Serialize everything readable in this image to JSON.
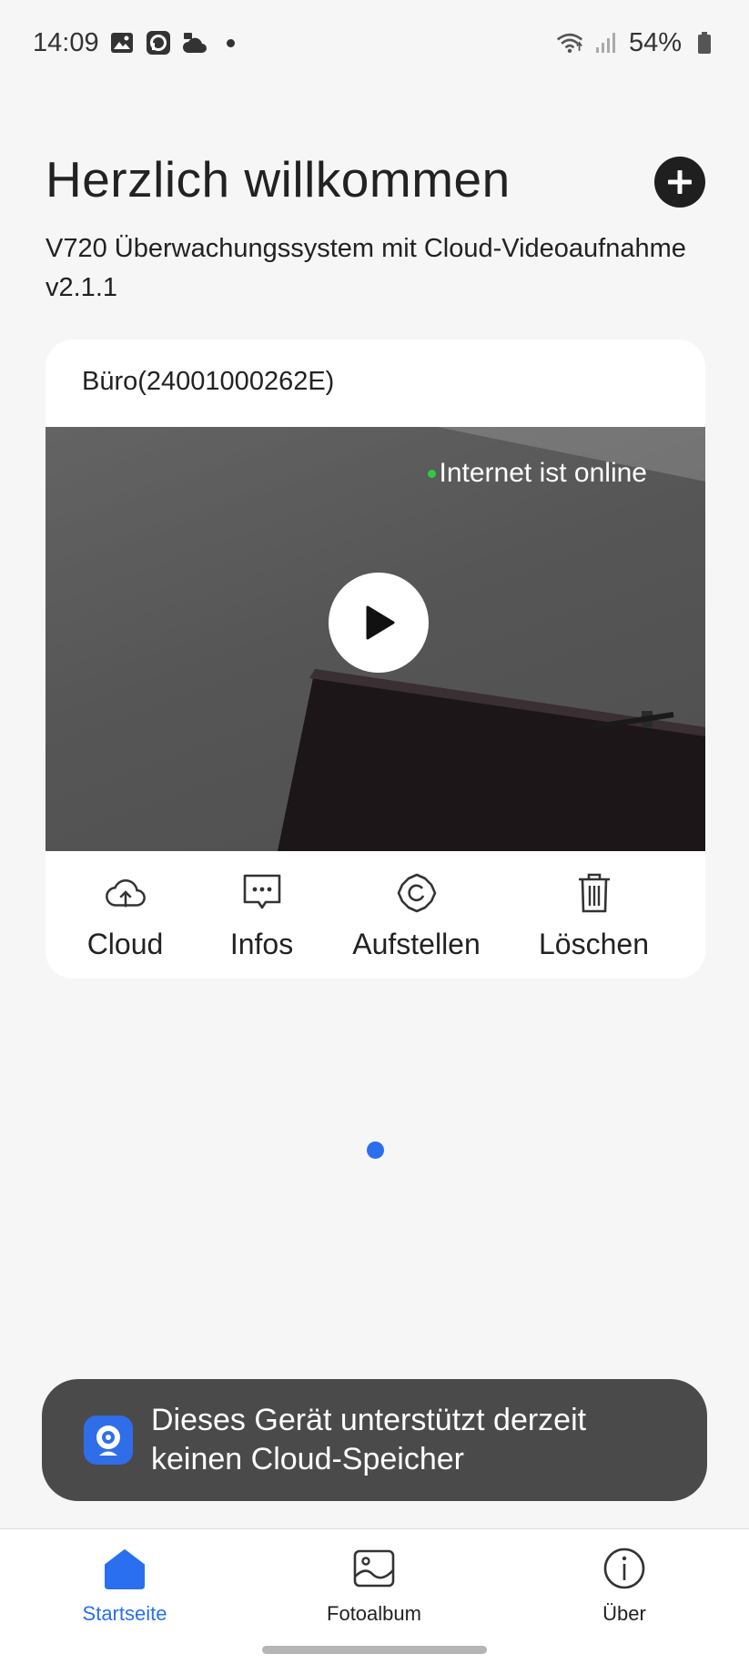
{
  "status_bar": {
    "time": "14:09",
    "battery": "54%",
    "icons": [
      "image-icon",
      "app-notification-icon",
      "cloud-camera-icon",
      "dot-icon",
      "wifi-icon",
      "signal-icon",
      "battery-icon"
    ]
  },
  "header": {
    "title": "Herzlich willkommen",
    "subtitle": "V720 Überwachungssystem mit Cloud-Videoaufnahme v2.1.1",
    "add_icon": "plus-circle-icon"
  },
  "device_card": {
    "name": "Büro(24001000262E)",
    "status": "Internet ist online",
    "status_color": "#2ecc40",
    "actions": [
      {
        "label": "Cloud",
        "icon": "cloud-upload-icon"
      },
      {
        "label": "Infos",
        "icon": "message-dots-icon"
      },
      {
        "label": "Aufstellen",
        "icon": "settings-gear-icon"
      },
      {
        "label": "Löschen",
        "icon": "trash-icon"
      }
    ]
  },
  "pager": {
    "pages": 1,
    "current": 1,
    "color": "#2a6ff0"
  },
  "toast": {
    "text": "Dieses Gerät unterstützt derzeit\nkeinen Cloud-Speicher",
    "icon": "webcam-app-icon"
  },
  "bottom_nav": {
    "items": [
      {
        "label": "Startseite",
        "icon": "home-icon",
        "active": true
      },
      {
        "label": "Fotoalbum",
        "icon": "photo-album-icon",
        "active": false
      },
      {
        "label": "Über",
        "icon": "info-circle-icon",
        "active": false
      }
    ],
    "accent": "#2a6ff0"
  }
}
